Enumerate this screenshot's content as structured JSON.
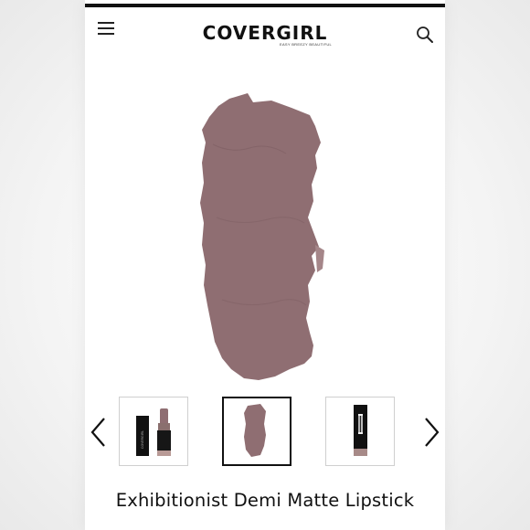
{
  "header": {
    "menu_icon": "hamburger-menu-icon",
    "brand": "COVERGIRL",
    "brand_tagline": "EASY BREEZY BEAUTIFUL",
    "search_icon": "search-icon"
  },
  "product": {
    "title": "Exhibitionist Demi Matte Lipstick",
    "swatch_color": "#8f6e72",
    "lipstick_label": "COVERGIRL"
  },
  "gallery": {
    "prev_icon": "chevron-left-icon",
    "next_icon": "chevron-right-icon",
    "thumbnails": [
      {
        "label": "Lipstick open with cap"
      },
      {
        "label": "Color swatch"
      },
      {
        "label": "Lipstick back with barcode"
      }
    ],
    "selected_index": 1
  },
  "colors": {
    "accent": "#111111",
    "swatch": "#8f6e72",
    "thumb_border": "#cfcfcf"
  }
}
